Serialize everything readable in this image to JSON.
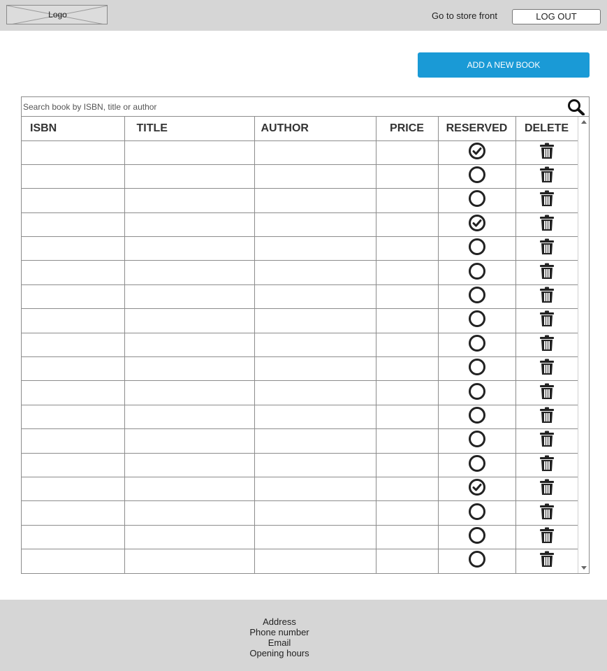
{
  "header": {
    "logo_label": "Logo",
    "store_link": "Go to store front",
    "logout_label": "LOG OUT"
  },
  "toolbar": {
    "add_book_label": "ADD A NEW BOOK"
  },
  "search": {
    "placeholder": "Search book by ISBN, title or author",
    "icon": "search-icon"
  },
  "table": {
    "columns": [
      "ISBN",
      "TITLE",
      "AUTHOR",
      "PRICE",
      "RESERVED",
      "DELETE"
    ],
    "rows": [
      {
        "isbn": "",
        "title": "",
        "author": "",
        "price": "",
        "reserved": true
      },
      {
        "isbn": "",
        "title": "",
        "author": "",
        "price": "",
        "reserved": false
      },
      {
        "isbn": "",
        "title": "",
        "author": "",
        "price": "",
        "reserved": false
      },
      {
        "isbn": "",
        "title": "",
        "author": "",
        "price": "",
        "reserved": true
      },
      {
        "isbn": "",
        "title": "",
        "author": "",
        "price": "",
        "reserved": false
      },
      {
        "isbn": "",
        "title": "",
        "author": "",
        "price": "",
        "reserved": false
      },
      {
        "isbn": "",
        "title": "",
        "author": "",
        "price": "",
        "reserved": false
      },
      {
        "isbn": "",
        "title": "",
        "author": "",
        "price": "",
        "reserved": false
      },
      {
        "isbn": "",
        "title": "",
        "author": "",
        "price": "",
        "reserved": false
      },
      {
        "isbn": "",
        "title": "",
        "author": "",
        "price": "",
        "reserved": false
      },
      {
        "isbn": "",
        "title": "",
        "author": "",
        "price": "",
        "reserved": false
      },
      {
        "isbn": "",
        "title": "",
        "author": "",
        "price": "",
        "reserved": false
      },
      {
        "isbn": "",
        "title": "",
        "author": "",
        "price": "",
        "reserved": false
      },
      {
        "isbn": "",
        "title": "",
        "author": "",
        "price": "",
        "reserved": false
      },
      {
        "isbn": "",
        "title": "",
        "author": "",
        "price": "",
        "reserved": true
      },
      {
        "isbn": "",
        "title": "",
        "author": "",
        "price": "",
        "reserved": false
      },
      {
        "isbn": "",
        "title": "",
        "author": "",
        "price": "",
        "reserved": false
      },
      {
        "isbn": "",
        "title": "",
        "author": "",
        "price": "",
        "reserved": false
      }
    ],
    "reserved_icon_checked": "check-circle-icon",
    "reserved_icon_unchecked": "circle-icon",
    "delete_icon": "trash-icon"
  },
  "footer": {
    "lines": [
      "Address",
      "Phone number",
      "Email",
      "Opening hours"
    ]
  },
  "colors": {
    "header_bg": "#d6d6d6",
    "accent": "#1a9ad6",
    "footer_bg": "#d6d6d6"
  }
}
